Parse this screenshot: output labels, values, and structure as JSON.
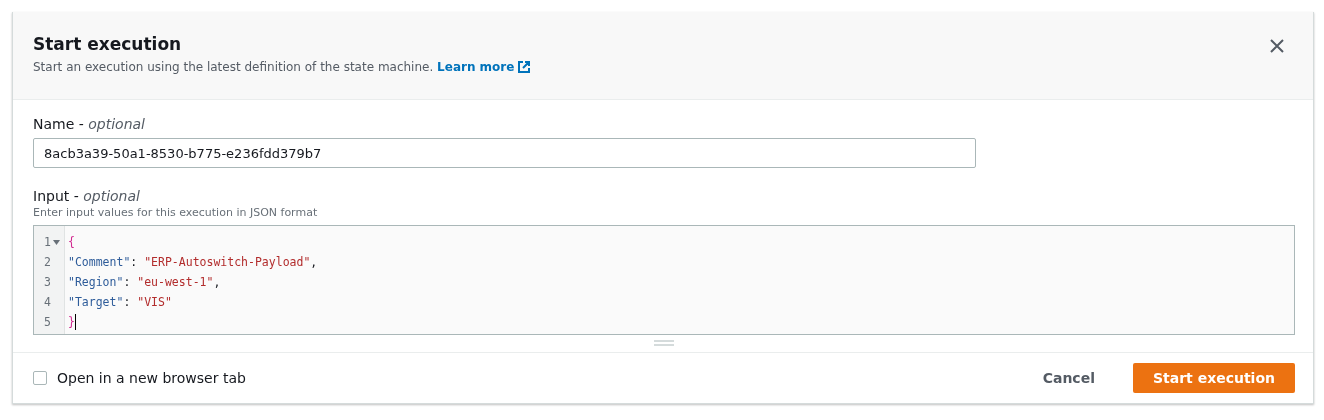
{
  "dialog": {
    "title": "Start execution",
    "description": "Start an execution using the latest definition of the state machine.",
    "learn_more": "Learn more"
  },
  "name_field": {
    "label": "Name - *optional*",
    "value": "8acb3a39-50a1-8530-b775-e236fdd379b7"
  },
  "input_field": {
    "label": "Input - *optional*",
    "hint": "Enter input values for this execution in JSON format",
    "lines": [
      {
        "number": "1",
        "foldable": true,
        "cursor": false,
        "tokens": [
          {
            "kind": "brace",
            "text": "{"
          }
        ]
      },
      {
        "number": "2",
        "foldable": false,
        "cursor": false,
        "tokens": [
          {
            "kind": "key",
            "text": "\"Comment\""
          },
          {
            "kind": "punct",
            "text": ": "
          },
          {
            "kind": "string",
            "text": "\"ERP-Autoswitch-Payload\""
          },
          {
            "kind": "punct",
            "text": ","
          }
        ]
      },
      {
        "number": "3",
        "foldable": false,
        "cursor": false,
        "tokens": [
          {
            "kind": "key",
            "text": "\"Region\""
          },
          {
            "kind": "punct",
            "text": ": "
          },
          {
            "kind": "string",
            "text": "\"eu-west-1\""
          },
          {
            "kind": "punct",
            "text": ","
          }
        ]
      },
      {
        "number": "4",
        "foldable": false,
        "cursor": false,
        "tokens": [
          {
            "kind": "key",
            "text": "\"Target\""
          },
          {
            "kind": "punct",
            "text": ": "
          },
          {
            "kind": "string",
            "text": "\"VIS\""
          }
        ]
      },
      {
        "number": "5",
        "foldable": false,
        "cursor": true,
        "tokens": [
          {
            "kind": "brace",
            "text": "}"
          }
        ]
      }
    ]
  },
  "new_tab": {
    "label": "Open in a new browser tab",
    "checked": false
  },
  "buttons": {
    "cancel": "Cancel",
    "start": "Start execution"
  }
}
